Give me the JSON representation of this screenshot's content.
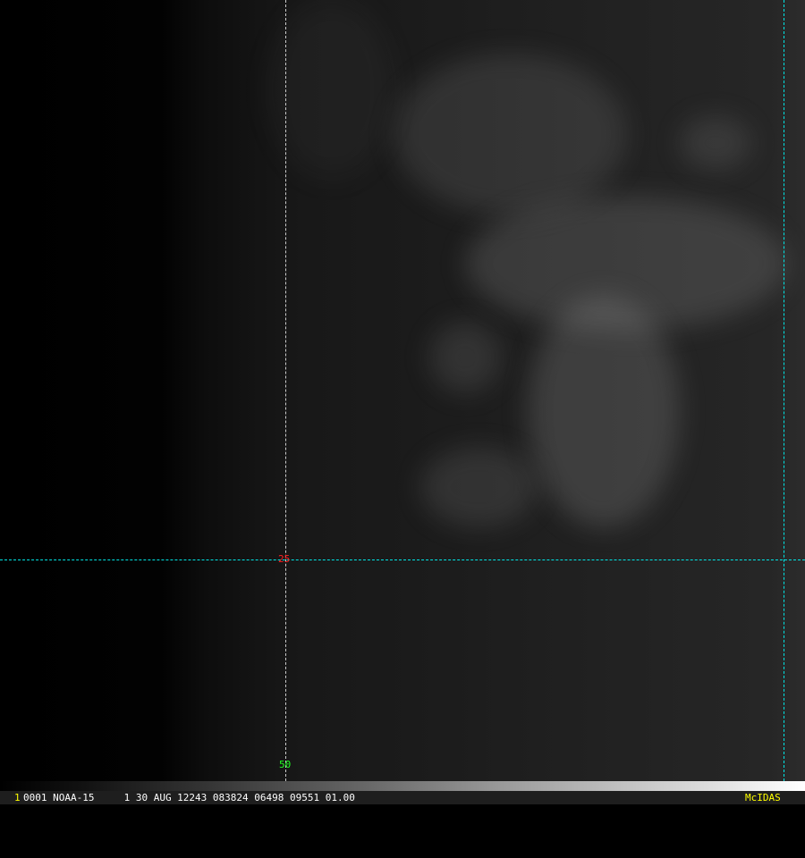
{
  "overlay": {
    "grid_color": "#00e5e5",
    "lat_label": "25",
    "lat_label_color": "#ff2020",
    "lon_label": "50",
    "lon_label_color": "#20ff20"
  },
  "footer": {
    "frame_number": "1",
    "info": "0001 NOAA-15     1 30 AUG 12243 083824 06498 09551 01.00",
    "brand": "McIDAS",
    "frame_color": "#ffff00",
    "brand_color": "#ffff00"
  }
}
